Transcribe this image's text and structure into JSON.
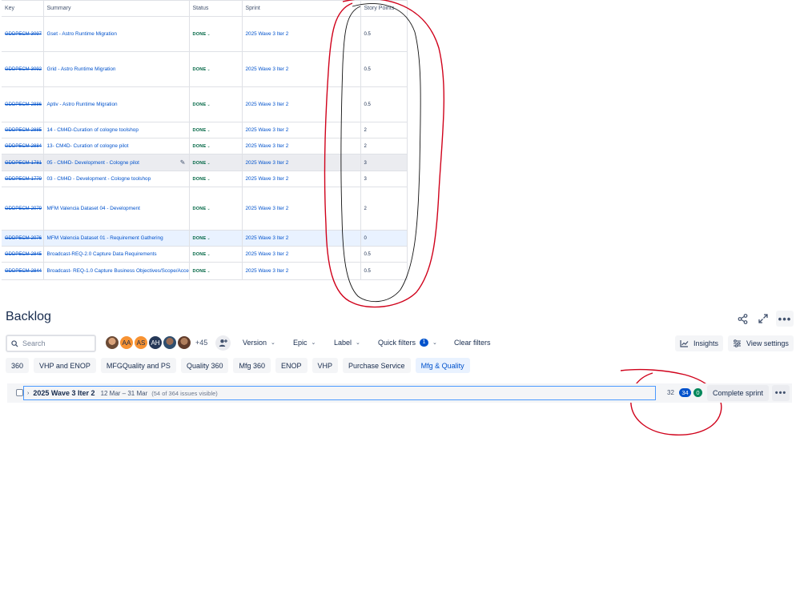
{
  "table": {
    "headers": {
      "key": "Key",
      "summary": "Summary",
      "status": "Status",
      "sprint": "Sprint",
      "points": "Story Points"
    },
    "rows": [
      {
        "key": "GDDPECM-3097",
        "summary": "Gset - Astro Runtime Migration",
        "status": "DONE",
        "sprint": "2025 Wave 3 Iter 2",
        "points": "0.5"
      },
      {
        "key": "GDDPECM-3092",
        "summary": "Grid - Astro Runtime Migration",
        "status": "DONE",
        "sprint": "2025 Wave 3 Iter 2",
        "points": "0.5"
      },
      {
        "key": "GDDPECM-2886",
        "summary": "Aptiv - Astro Runtime Migration",
        "status": "DONE",
        "sprint": "2025 Wave 3 Iter 2",
        "points": "0.5"
      },
      {
        "key": "GDDPECM-2885",
        "summary": "14 - CM4D-Curation of cologne toolshop",
        "status": "DONE",
        "sprint": "2025 Wave 3 Iter 2",
        "points": "2"
      },
      {
        "key": "GDDPECM-2884",
        "summary": "13- CM4D- Curation of cologne pilot",
        "status": "DONE",
        "sprint": "2025 Wave 3 Iter 2",
        "points": "2"
      },
      {
        "key": "GDDPECM-1781",
        "summary": "05 - CM4D- Development - Cologne pilot",
        "status": "DONE",
        "sprint": "2025 Wave 3 Iter 2",
        "points": "3"
      },
      {
        "key": "GDDPECM-1779",
        "summary": "03 - CM4D - Development - Cologne toolshop",
        "status": "DONE",
        "sprint": "2025 Wave 3 Iter 2",
        "points": "3"
      },
      {
        "key": "GDDPECM-2079",
        "summary": "MFM Valencia Dataset 04 - Development",
        "status": "DONE",
        "sprint": "2025 Wave 3 Iter 2",
        "points": "2"
      },
      {
        "key": "GDDPECM-2076",
        "summary": "MFM Valencia Dataset 01 - Requirement Gathering",
        "status": "DONE",
        "sprint": "2025 Wave 3 Iter 2",
        "points": "0"
      },
      {
        "key": "GDDPECM-2845",
        "summary": "Broadcast-REQ-2.0 Capture Data Requirements",
        "status": "DONE",
        "sprint": "2025 Wave 3 Iter 2",
        "points": "0.5"
      },
      {
        "key": "GDDPECM-2844",
        "summary": "Broadcast- REQ-1.0 Capture Business Objectives/Scope/Acceptance Criteria",
        "status": "DONE",
        "sprint": "2025 Wave 3 Iter 2",
        "points": "0.5"
      }
    ]
  },
  "backlog": {
    "title": "Backlog",
    "search_placeholder": "Search",
    "avatars": [
      {
        "initials": "",
        "kind": "photo"
      },
      {
        "initials": "AA",
        "kind": "initials",
        "color": "#f79232"
      },
      {
        "initials": "AS",
        "kind": "initials",
        "color": "#f79232"
      },
      {
        "initials": "AH",
        "kind": "initials",
        "color": "#253858"
      },
      {
        "initials": "",
        "kind": "photo"
      },
      {
        "initials": "",
        "kind": "photo"
      }
    ],
    "more_avatars": "+45",
    "filters": {
      "version": "Version",
      "epic": "Epic",
      "label": "Label",
      "quick_filters": "Quick filters",
      "quick_filters_count": "1",
      "clear": "Clear filters"
    },
    "insights": "Insights",
    "view_settings": "View settings",
    "chips": [
      "360",
      "VHP and ENOP",
      "MFGQuality and PS",
      "Quality 360",
      "Mfg 360",
      "ENOP",
      "VHP",
      "Purchase Service",
      "Mfg & Quality"
    ],
    "active_chip": "Mfg & Quality",
    "sprint": {
      "name": "2025 Wave 3 Iter 2",
      "dates": "12 Mar – 31 Mar",
      "visible": "(54 of 364 issues visible)",
      "count_todo": "32",
      "count_in_progress": "34",
      "count_done": "0",
      "complete_label": "Complete sprint"
    }
  },
  "colors": {
    "link": "#0052cc",
    "done_green": "#006644",
    "annotation_red": "#d0021b"
  }
}
